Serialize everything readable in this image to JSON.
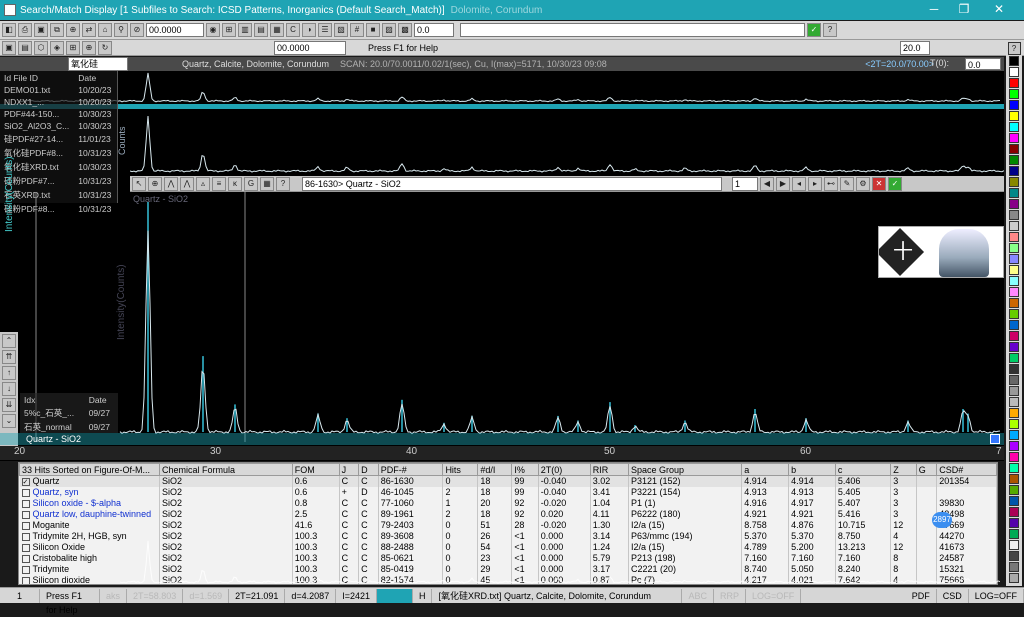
{
  "title": "Search/Match Display [1 Subfiles to Search: ICSD Patterns, Inorganics (Default Search_Match)]",
  "title_suffix": "Dolomite, Corundum",
  "toolbar": {
    "angle_field": "00.0000",
    "zero_field": "0.0",
    "angle_field2": "00.0000",
    "help_text": "Press F1 for Help",
    "range_value": "20.0"
  },
  "scan_bar": {
    "file": "氧化硅XRD.txt",
    "phases": "Quartz, Calcite, Dolomite, Corundum",
    "scan_info": "SCAN: 20.0/70.0011/0.02/1(sec), Cu, I(max)=5171, 10/30/23 09:08",
    "range": "<2T=20.0/70.00>",
    "t0": "T(0):",
    "t0_value": "0.0"
  },
  "file_list": {
    "headers": [
      "Id File ID",
      "Date"
    ],
    "rows": [
      [
        "DEMO01.txt",
        "10/20/23"
      ],
      [
        "NDXX1_...",
        "10/20/23"
      ],
      [
        "PDF#44-150...",
        "10/30/23"
      ],
      [
        "SiO2_Al2O3_C...",
        "10/30/23"
      ],
      [
        "硅PDF#27-14...",
        "11/01/23"
      ],
      [
        "氧化硅PDF#8...",
        "10/31/23"
      ],
      [
        "氧化硅XRD.txt",
        "10/30/23"
      ],
      [
        "硅粉PDF#7...",
        "10/31/23"
      ],
      [
        "石英XRD.txt",
        "10/31/23"
      ],
      [
        "硅粉PDF#8...",
        "10/31/23"
      ]
    ],
    "rows2_header": [
      "Idx",
      "Date"
    ],
    "rows2": [
      [
        "5%c_石英_...",
        "09/27"
      ],
      [
        "石英_normal",
        "09/27"
      ]
    ]
  },
  "axis_labels": {
    "intensity_counts": "Intensity(Counts)",
    "counts": "Counts"
  },
  "inner_window": {
    "title": "Quartz - SiO2",
    "phase_field": "86-1630> Quartz - SiO2",
    "count": "1"
  },
  "lower_label": "Quartz - SiO2",
  "x_ticks": [
    "20",
    "30",
    "40",
    "50",
    "60",
    "7"
  ],
  "hits_table": {
    "header_first": "33 Hits Sorted on Figure-Of-M...",
    "columns": [
      "Chemical Formula",
      "FOM",
      "J",
      "D",
      "PDF-#",
      "Hits",
      "#d/I",
      "I%",
      "2T(0)",
      "RIR",
      "Space Group",
      "a",
      "b",
      "c",
      "Z",
      "G",
      "CSD#"
    ],
    "rows": [
      {
        "name": "Quartz",
        "color": "#000000",
        "checked": true,
        "cells": [
          "SiO2",
          "0.6",
          "C",
          "C",
          "86-1630",
          "0",
          "18",
          "99",
          "-0.040",
          "3.02",
          "P3121 (152)",
          "4.914",
          "4.914",
          "5.406",
          "3",
          "",
          "201354"
        ]
      },
      {
        "name": "Quartz, syn",
        "color": "#1030d0",
        "checked": false,
        "cells": [
          "SiO2",
          "0.6",
          "+",
          "D",
          "46-1045",
          "2",
          "18",
          "99",
          "-0.040",
          "3.41",
          "P3221 (154)",
          "4.913",
          "4.913",
          "5.405",
          "3",
          "",
          ""
        ]
      },
      {
        "name": "Silicon oxide - $-alpha",
        "color": "#1030d0",
        "checked": false,
        "cells": [
          "SiO2",
          "0.8",
          "C",
          "C",
          "77-1060",
          "1",
          "20",
          "92",
          "-0.020",
          "1.04",
          "P1 (1)",
          "4.916",
          "4.917",
          "5.407",
          "3",
          "",
          "39830"
        ]
      },
      {
        "name": "Quartz low, dauphine-twinned",
        "color": "#1030d0",
        "checked": false,
        "cells": [
          "SiO2",
          "2.5",
          "C",
          "C",
          "89-1961",
          "2",
          "18",
          "92",
          "0.020",
          "4.11",
          "P6222 (180)",
          "4.921",
          "4.921",
          "5.416",
          "3",
          "",
          "42498"
        ]
      },
      {
        "name": "Moganite",
        "color": "#000000",
        "checked": false,
        "cells": [
          "SiO2",
          "41.6",
          "C",
          "C",
          "79-2403",
          "0",
          "51",
          "28",
          "-0.020",
          "1.30",
          "I2/a (15)",
          "8.758",
          "4.876",
          "10.715",
          "12",
          "",
          "67669"
        ]
      },
      {
        "name": "Tridymite 2H, HGB, syn",
        "color": "#000000",
        "checked": false,
        "cells": [
          "SiO2",
          "100.3",
          "C",
          "C",
          "89-3608",
          "0",
          "26",
          "<1",
          "0.000",
          "3.14",
          "P63/mmc (194)",
          "5.370",
          "5.370",
          "8.750",
          "4",
          "",
          "44270"
        ]
      },
      {
        "name": "Silicon Oxide",
        "color": "#000000",
        "checked": false,
        "cells": [
          "SiO2",
          "100.3",
          "C",
          "C",
          "88-2488",
          "0",
          "54",
          "<1",
          "0.000",
          "1.24",
          "I2/a (15)",
          "4.789",
          "5.200",
          "13.213",
          "12",
          "",
          "41673"
        ]
      },
      {
        "name": "Cristobalite high",
        "color": "#000000",
        "checked": false,
        "cells": [
          "SiO2",
          "100.3",
          "C",
          "C",
          "85-0621",
          "0",
          "23",
          "<1",
          "0.000",
          "5.79",
          "P213 (198)",
          "7.160",
          "7.160",
          "7.160",
          "8",
          "",
          "24587"
        ]
      },
      {
        "name": "Tridymite",
        "color": "#000000",
        "checked": false,
        "cells": [
          "SiO2",
          "100.3",
          "C",
          "C",
          "85-0419",
          "0",
          "29",
          "<1",
          "0.000",
          "3.17",
          "C2221 (20)",
          "8.740",
          "5.050",
          "8.240",
          "8",
          "",
          "15321"
        ]
      },
      {
        "name": "Silicon dioxide",
        "color": "#000000",
        "checked": false,
        "cells": [
          "SiO2",
          "100.3",
          "C",
          "C",
          "82-1574",
          "0",
          "45",
          "<1",
          "0.000",
          "0.87",
          "Pc (7)",
          "4.217",
          "4.021",
          "7.642",
          "4",
          "",
          "75668"
        ]
      }
    ]
  },
  "badge": "2897",
  "status": {
    "index": "1",
    "help": "Press F1 for Help",
    "ghost1": "aks",
    "ghost2": "2T=58.803",
    "ghost3": "d=1.569",
    "two_theta": "2T=21.091",
    "d": "d=4.2087",
    "intensity": "I=2421",
    "h": "H",
    "scan_info": "[氧化硅XRD.txt] Quartz, Calcite, Dolomite, Corundum",
    "abc": "ABC",
    "rrp": "RRP",
    "log_ghost": "LOG=OFF",
    "pdf": "PDF",
    "csd": "CSD",
    "log": "LOG=OFF"
  },
  "colors": {
    "title_bar": "#1fa4b4",
    "trace": "#d8e8ee",
    "stick": "#36c0d8",
    "hit_blue": "#1030d0"
  }
}
